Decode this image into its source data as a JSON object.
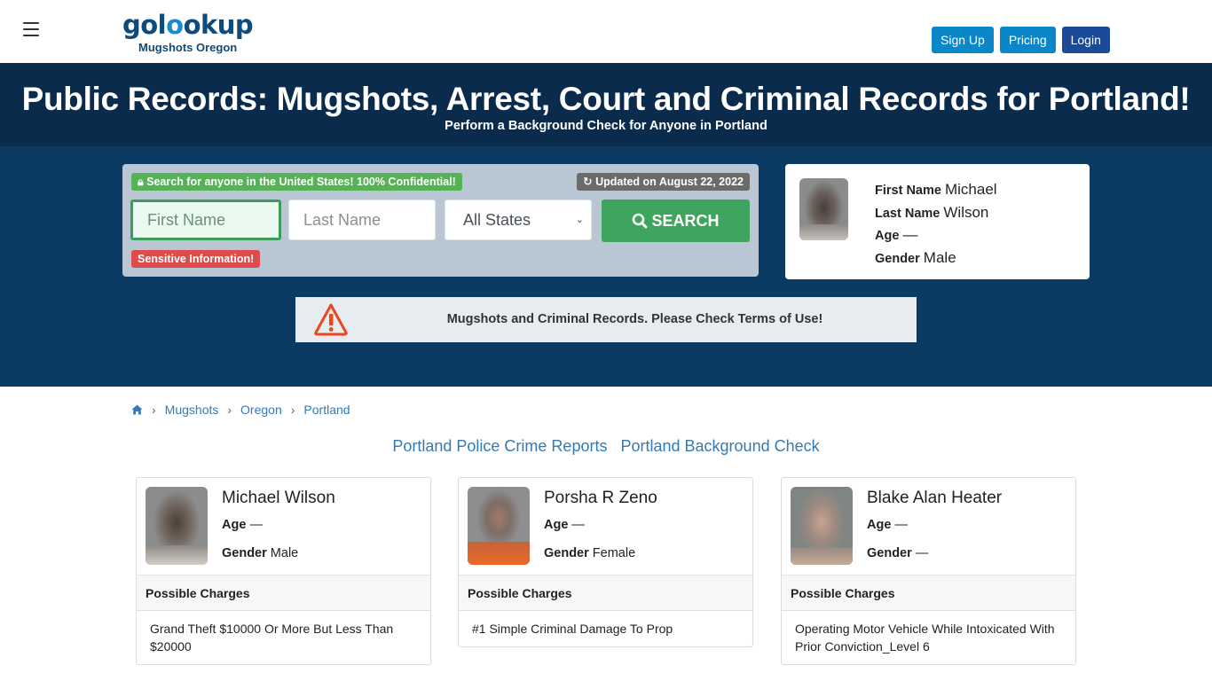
{
  "header": {
    "logo_text": "golookup",
    "logo_subtitle": "Mugshots Oregon",
    "nav_buttons": [
      {
        "label": "Sign Up"
      },
      {
        "label": "Pricing"
      },
      {
        "label": "Login"
      }
    ]
  },
  "hero": {
    "title": "Public Records: Mugshots, Arrest, Court and Criminal Records for Portland!",
    "subtitle": "Perform a Background Check for Anyone in Portland"
  },
  "search": {
    "confidential_badge": "Search for anyone in the United States! 100% Confidential!",
    "updated_badge": "Updated on August 22, 2022",
    "first_name_placeholder": "First Name",
    "last_name_placeholder": "Last Name",
    "state_selected": "All States",
    "search_button": "SEARCH",
    "sensitive_badge": "Sensitive Information!"
  },
  "featured_profile": {
    "first_name_label": "First Name",
    "first_name": "Michael",
    "last_name_label": "Last Name",
    "last_name": "Wilson",
    "age_label": "Age",
    "age": "—",
    "gender_label": "Gender",
    "gender": "Male"
  },
  "notice": {
    "text": "Mugshots and Criminal Records. Please Check Terms of Use!"
  },
  "breadcrumb": {
    "items": [
      {
        "label": "Mugshots"
      },
      {
        "label": "Oregon"
      },
      {
        "label": "Portland"
      }
    ]
  },
  "related_links": [
    {
      "label": "Portland Police Crime Reports"
    },
    {
      "label": "Portland Background Check"
    }
  ],
  "records": [
    {
      "name": "Michael Wilson",
      "age_label": "Age",
      "age": "—",
      "gender_label": "Gender",
      "gender": "Male",
      "charges_header": "Possible Charges",
      "charges": "Grand Theft $10000 Or More But Less Than $20000"
    },
    {
      "name": "Porsha R Zeno",
      "age_label": "Age",
      "age": "—",
      "gender_label": "Gender",
      "gender": "Female",
      "charges_header": "Possible Charges",
      "charges": "#1 Simple Criminal Damage To Prop"
    },
    {
      "name": "Blake Alan Heater",
      "age_label": "Age",
      "age": "—",
      "gender_label": "Gender",
      "gender": "—",
      "charges_header": "Possible Charges",
      "charges": "Operating Motor Vehicle While Intoxicated With Prior Conviction_Level 6"
    }
  ],
  "colors": {
    "hero_title_bg": "#0a2b4b",
    "hero_bg": "#0b3a62",
    "search_green": "#3fa45d",
    "badge_green": "#55b356",
    "badge_red": "#de4b4b",
    "link_blue": "#337ab7",
    "nav_blue": "#0b87c9",
    "login_blue": "#1b4a98",
    "warning_orange": "#e8481c"
  }
}
